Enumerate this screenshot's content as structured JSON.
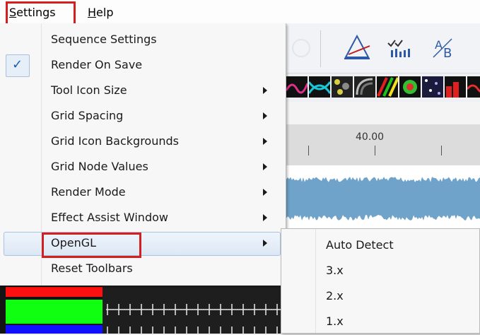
{
  "menubar": {
    "settings_label": "Settings",
    "settings_underline": "S",
    "settings_rest": "ettings",
    "help_underline": "H",
    "help_rest": "elp"
  },
  "settings_menu": {
    "items": [
      {
        "label": "Sequence Settings",
        "checked": false,
        "submenu": false
      },
      {
        "label": "Render On Save",
        "checked": true,
        "submenu": false
      },
      {
        "label": "Tool Icon Size",
        "checked": false,
        "submenu": true
      },
      {
        "label": "Grid Spacing",
        "checked": false,
        "submenu": true
      },
      {
        "label": "Grid Icon Backgrounds",
        "checked": false,
        "submenu": true
      },
      {
        "label": "Grid Node Values",
        "checked": false,
        "submenu": true
      },
      {
        "label": "Render Mode",
        "checked": false,
        "submenu": true
      },
      {
        "label": "Effect Assist Window",
        "checked": false,
        "submenu": true
      },
      {
        "label": "OpenGL",
        "checked": false,
        "submenu": true
      },
      {
        "label": "Reset Toolbars",
        "checked": false,
        "submenu": false
      }
    ],
    "check_glyph": "✓"
  },
  "opengl_submenu": {
    "items": [
      {
        "label": "Auto Detect"
      },
      {
        "label": "3.x"
      },
      {
        "label": "2.x"
      },
      {
        "label": "1.x"
      }
    ]
  },
  "ruler": {
    "label": "40.00"
  },
  "colors": {
    "highlight_box": "#d31f1f",
    "waveform": "#6fa3c9",
    "check": "#1b5bb5"
  },
  "icons": [
    "pen-triangle-icon",
    "checkmarks-bars-icon",
    "ab-text-icon",
    "gear-ghost-icon"
  ]
}
